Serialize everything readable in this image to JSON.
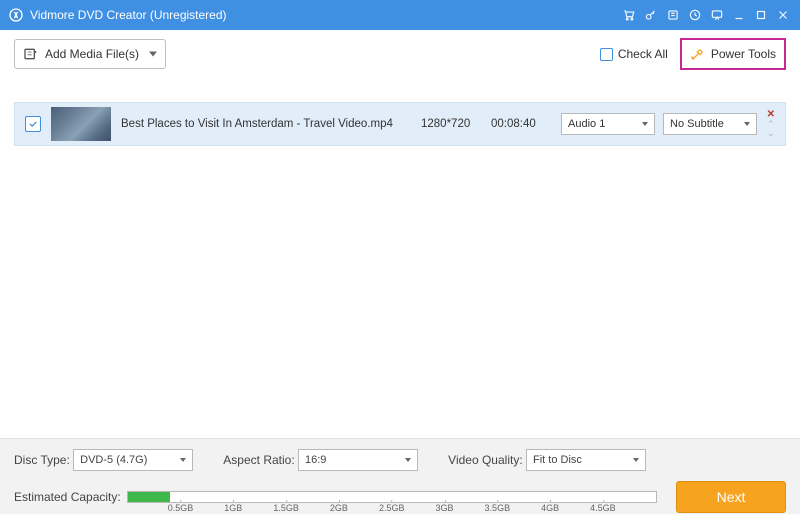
{
  "titlebar": {
    "title": "Vidmore DVD Creator (Unregistered)"
  },
  "toolbar": {
    "add_label": "Add Media File(s)",
    "check_all_label": "Check All",
    "power_tools_label": "Power Tools"
  },
  "media": {
    "items": [
      {
        "checked": true,
        "filename": "Best Places to Visit In Amsterdam - Travel Video.mp4",
        "resolution": "1280*720",
        "duration": "00:08:40",
        "audio": "Audio 1",
        "subtitle": "No Subtitle"
      }
    ]
  },
  "bottom": {
    "disc_type_label": "Disc Type:",
    "disc_type_value": "DVD-5 (4.7G)",
    "aspect_ratio_label": "Aspect Ratio:",
    "aspect_ratio_value": "16:9",
    "video_quality_label": "Video Quality:",
    "video_quality_value": "Fit to Disc",
    "capacity_label": "Estimated Capacity:",
    "capacity_fill_percent": 8,
    "ticks": [
      "0.5GB",
      "1GB",
      "1.5GB",
      "2GB",
      "2.5GB",
      "3GB",
      "3.5GB",
      "4GB",
      "4.5GB"
    ],
    "next_label": "Next"
  }
}
